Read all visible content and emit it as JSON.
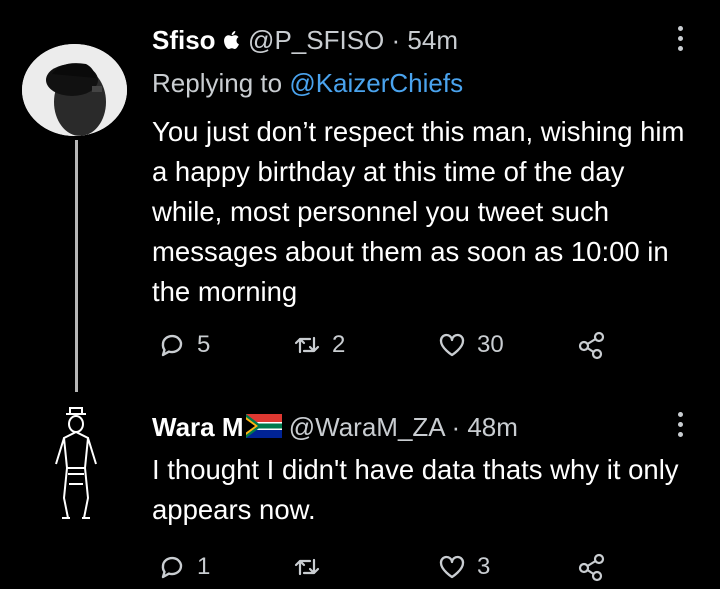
{
  "tweets": [
    {
      "name": "Sfiso",
      "badge_icon": "apple-icon",
      "handle": "@P_SFISO",
      "separator": "·",
      "time": "54m",
      "replying_prefix": "Replying to",
      "replying_to": "@KaizerChiefs",
      "text": "You just don’t respect this man, wishing him a happy birthday at this time of the day while, most personnel you tweet such messages about them as soon as 10:00 in the morning",
      "replies": "5",
      "retweets": "2",
      "likes": "30"
    },
    {
      "name": "Wara M",
      "badge_icon": "south-africa-flag-icon",
      "handle": "@WaraM_ZA",
      "separator": "·",
      "time": "48m",
      "text": "I thought I didn't have data thats why it only appears now.",
      "replies": "1",
      "retweets": "",
      "likes": "3"
    }
  ],
  "colors": {
    "background": "#000000",
    "text": "#ffffff",
    "secondary": "#c9cdd1",
    "link": "#4aa3ee"
  }
}
